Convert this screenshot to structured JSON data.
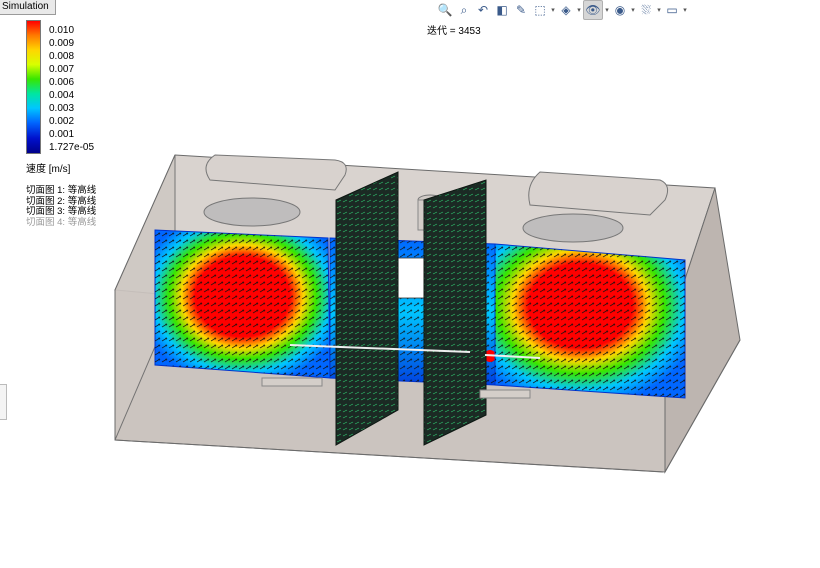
{
  "app": {
    "tab_label": "Simulation"
  },
  "toolbar": {
    "icons": [
      "zoom-to-fit-icon",
      "zoom-area-icon",
      "previous-view-icon",
      "section-view-icon",
      "dynamic-annotation-icon",
      "view-orientation-icon",
      "display-style-icon",
      "hide-show-items-icon",
      "edit-appearance-icon",
      "apply-scene-icon",
      "view-settings-icon"
    ],
    "glyphs": [
      "🔍",
      "⌕",
      "↶",
      "◧",
      "✎",
      "⬚",
      "◈",
      "👁",
      "◉",
      "⛆",
      "▭"
    ]
  },
  "status": {
    "iteration_text": "迭代 = 3453"
  },
  "legend": {
    "ticks": [
      "0.010",
      "0.009",
      "0.008",
      "0.007",
      "0.006",
      "0.004",
      "0.003",
      "0.002",
      "0.001",
      "1.727e-05"
    ],
    "unit_label": "速度 [m/s]",
    "colors": [
      "#ff0000",
      "#ff7a00",
      "#ffd600",
      "#d8ff00",
      "#37e600",
      "#00e6a0",
      "#00c6ff",
      "#0066ff",
      "#0010cc",
      "#00008a"
    ]
  },
  "cut_plots": [
    {
      "label": "切面图 1: 等高线",
      "active": true
    },
    {
      "label": "切面图 2: 等高线",
      "active": true
    },
    {
      "label": "切面图 3: 等高线",
      "active": true
    },
    {
      "label": "切面图 4: 等高线",
      "active": false
    }
  ]
}
